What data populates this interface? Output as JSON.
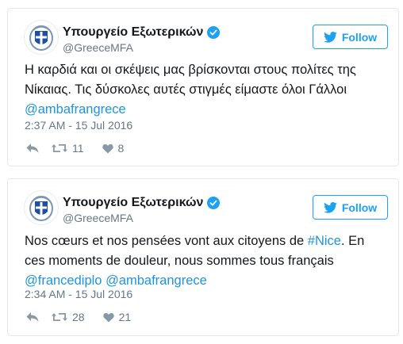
{
  "colors": {
    "accent": "#1da1f2",
    "link": "#1b95e0",
    "text": "#14171a",
    "muted": "#657786",
    "border": "#e1e8ed"
  },
  "tweets": [
    {
      "author_name": "Υπουργείο Εξωτερικών",
      "handle": "@GreeceMFA",
      "follow_label": "Follow",
      "text_part1": "Η καρδιά και οι σκέψεις μας βρίσκονται στους πολίτες της Νίκαιας. Τις δύσκολες αυτές στιγμές είμαστε όλοι Γάλλοι",
      "mention1": "@ambafrangrece",
      "timestamp": "2:37 AM - 15 Jul 2016",
      "retweets": "11",
      "likes": "8",
      "icons": [
        "greek-emblem-icon",
        "verified-badge-icon",
        "twitter-bird-icon",
        "reply-icon",
        "retweet-icon",
        "heart-icon"
      ]
    },
    {
      "author_name": "Υπουργείο Εξωτερικών",
      "handle": "@GreeceMFA",
      "follow_label": "Follow",
      "text_part1": "Nos cœurs et nos pensées vont aux citoyens de ",
      "hashtag": "#Nice",
      "text_part2": ". En ces moments de douleur, nous sommes tous français ",
      "mention1": "@francediplo",
      "mention2": "@ambafrangrece",
      "timestamp": "2:34 AM - 15 Jul 2016",
      "retweets": "28",
      "likes": "21",
      "icons": [
        "greek-emblem-icon",
        "verified-badge-icon",
        "twitter-bird-icon",
        "reply-icon",
        "retweet-icon",
        "heart-icon"
      ]
    }
  ]
}
